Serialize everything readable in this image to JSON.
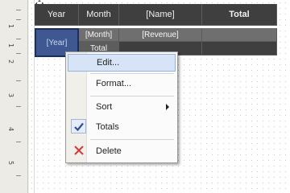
{
  "ruler": {
    "numbers": [
      "1",
      "1",
      "2",
      "3",
      "4",
      "5"
    ]
  },
  "matrix": {
    "headers": {
      "year": "Year",
      "month": "Month",
      "name": "[Name]",
      "total": "Total"
    },
    "year_cell": "[Year]",
    "rows": [
      {
        "month": "[Month]",
        "value": "[Revenue]"
      },
      {
        "month": "Total",
        "value": ""
      }
    ]
  },
  "context_menu": {
    "items": [
      {
        "label": "Edit...",
        "highlighted": true
      },
      {
        "label": "Format..."
      },
      {
        "label": "Sort",
        "has_submenu": true
      },
      {
        "label": "Totals",
        "checked": true
      },
      {
        "label": "Delete",
        "icon": "delete-x-icon"
      }
    ]
  },
  "colors": {
    "header_bg": "#3f3f3f",
    "selected_cell_bg": "#3f5891",
    "menu_highlight": "#d7e4f7",
    "delete_icon": "#d23a3a",
    "check_icon": "#2b4f99"
  }
}
